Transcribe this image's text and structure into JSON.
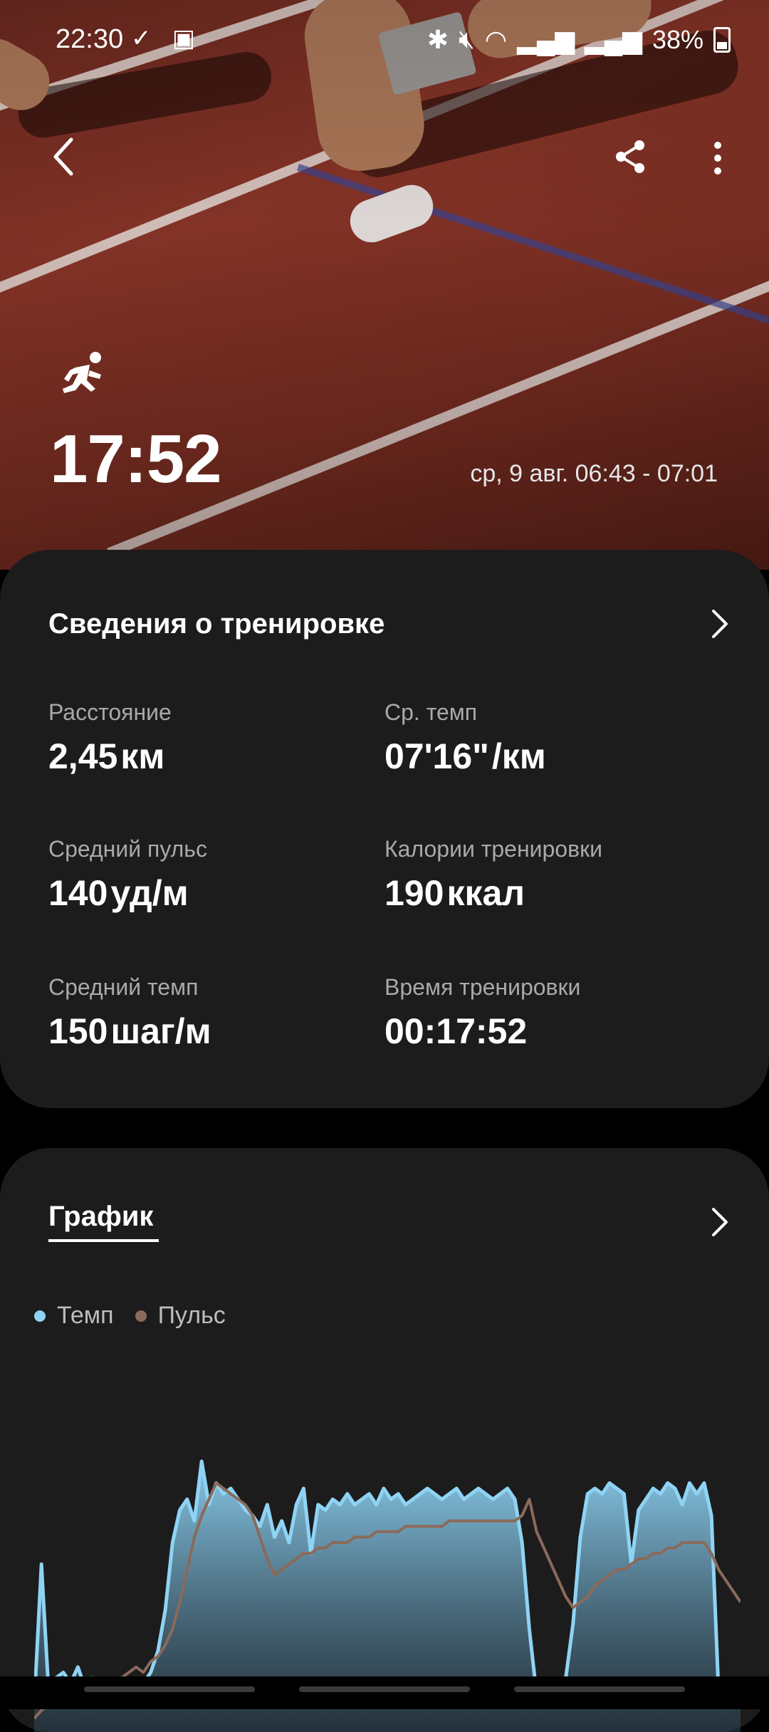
{
  "status_bar": {
    "time": "22:30",
    "battery": "38%"
  },
  "header": {
    "duration": "17:52",
    "date_range": "ср, 9 авг. 06:43 - 07:01"
  },
  "workout_details": {
    "title": "Сведения о тренировке",
    "metrics": [
      {
        "label": "Расстояние",
        "value": "2,45",
        "unit": "км"
      },
      {
        "label": "Ср. темп",
        "value": "07'16\"",
        "unit": "/км"
      },
      {
        "label": "Средний пульс",
        "value": "140",
        "unit": "уд/м"
      },
      {
        "label": "Калории тренировки",
        "value": "190",
        "unit": "ккал"
      },
      {
        "label": "Средний темп",
        "value": "150",
        "unit": "шаг/м"
      },
      {
        "label": "Время тренировки",
        "value": "00:17:52",
        "unit": ""
      }
    ]
  },
  "graph": {
    "title": "График",
    "legend": [
      {
        "name": "Темп",
        "color": "#8fd3f4"
      },
      {
        "name": "Пульс",
        "color": "#8a6a5a"
      }
    ]
  },
  "chart_data": {
    "type": "area",
    "series": [
      {
        "name": "Темп",
        "color": "#8fd3f4",
        "values": [
          10,
          62,
          14,
          20,
          22,
          18,
          24,
          16,
          20,
          14,
          10,
          15,
          20,
          12,
          14,
          18,
          22,
          30,
          45,
          70,
          82,
          86,
          78,
          100,
          84,
          92,
          88,
          90,
          86,
          82,
          80,
          76,
          84,
          72,
          78,
          70,
          84,
          90,
          66,
          84,
          82,
          86,
          84,
          88,
          84,
          86,
          88,
          84,
          90,
          86,
          88,
          84,
          86,
          88,
          90,
          88,
          86,
          88,
          90,
          86,
          88,
          90,
          88,
          86,
          88,
          90,
          86,
          70,
          38,
          14,
          12,
          10,
          14,
          20,
          40,
          72,
          88,
          90,
          88,
          92,
          90,
          88,
          62,
          82,
          86,
          90,
          88,
          92,
          90,
          84,
          92,
          88,
          92,
          80,
          14,
          10,
          12,
          12
        ]
      },
      {
        "name": "Пульс",
        "color": "#8a6a5a",
        "values": [
          5,
          8,
          10,
          12,
          15,
          14,
          16,
          18,
          17,
          20,
          19,
          18,
          20,
          22,
          24,
          22,
          26,
          28,
          32,
          38,
          48,
          60,
          72,
          80,
          86,
          92,
          90,
          88,
          86,
          84,
          80,
          72,
          64,
          58,
          60,
          62,
          64,
          66,
          66,
          68,
          68,
          70,
          70,
          70,
          72,
          72,
          72,
          74,
          74,
          74,
          74,
          76,
          76,
          76,
          76,
          76,
          76,
          78,
          78,
          78,
          78,
          78,
          78,
          78,
          78,
          78,
          78,
          80,
          86,
          74,
          68,
          62,
          56,
          50,
          46,
          48,
          50,
          54,
          56,
          58,
          60,
          60,
          62,
          64,
          64,
          66,
          66,
          68,
          68,
          70,
          70,
          70,
          70,
          66,
          60,
          56,
          52,
          48
        ]
      }
    ],
    "ylim": [
      0,
      100
    ],
    "grid": false
  }
}
